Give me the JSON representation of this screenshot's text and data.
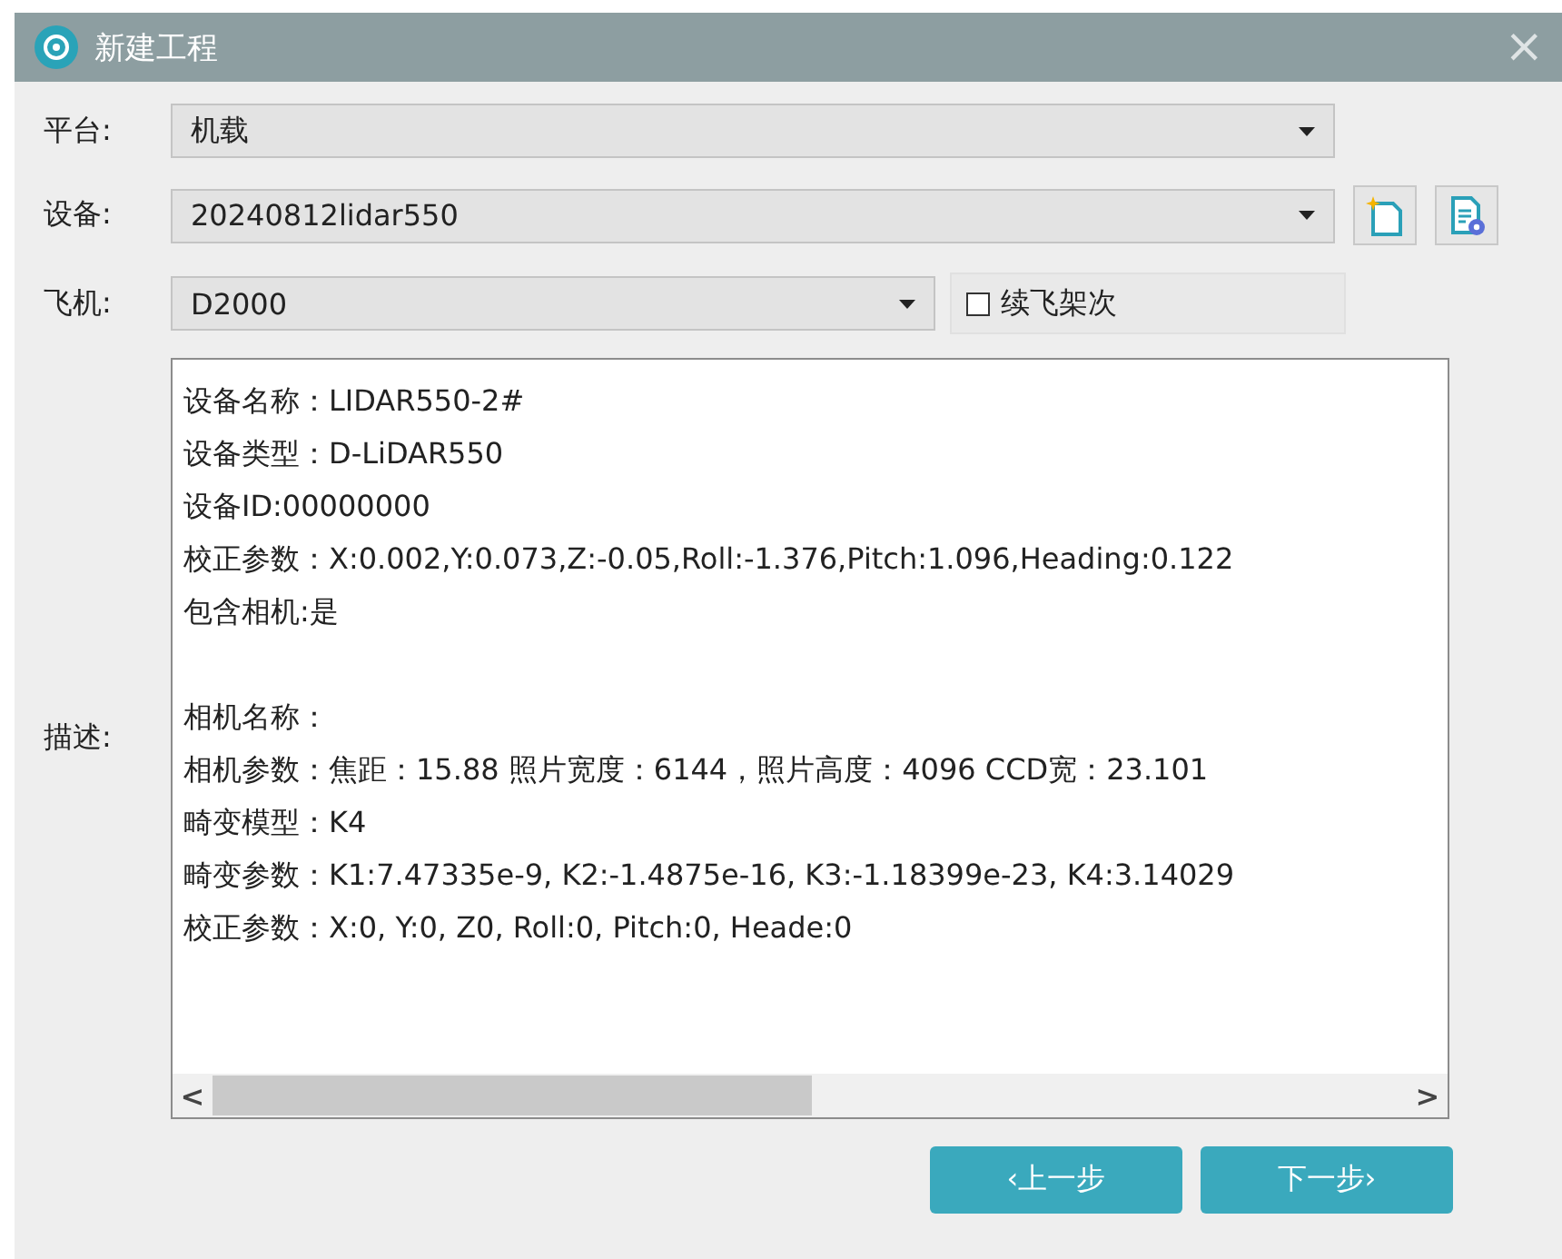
{
  "window": {
    "title": "新建工程",
    "close": "×"
  },
  "fields": [
    {
      "label": "平台:",
      "value": "机载",
      "kind": "combo"
    },
    {
      "label": "设备:",
      "value": "20240812lidar550",
      "kind": "combo-tools"
    },
    {
      "label": "飞机:",
      "value": "D2000",
      "kind": "combo-check",
      "check": {
        "label": "续飞架次",
        "checked": false
      }
    }
  ],
  "description": {
    "label": "描述:",
    "device_lines": [
      "设备名称：LIDAR550-2#",
      "设备类型：D-LiDAR550",
      "设备ID:00000000",
      "校正参数：X:0.002,Y:0.073,Z:-0.05,Roll:-1.376,Pitch:1.096,Heading:0.122",
      "包含相机:是"
    ],
    "camera_lines": [
      "相机名称：",
      "相机参数：焦距：15.88 照片宽度：6144，照片高度：4096 CCD宽：23.101",
      "畸变模型：K4",
      "畸变参数：K1:7.47335e-9, K2:-1.4875e-16, K3:-1.18399e-23, K4:3.14029",
      "校正参数：X:0, Y:0, Z0, Roll:0, Pitch:0, Heade:0"
    ],
    "scroll_left": "<",
    "scroll_right": ">"
  },
  "buttons": [
    {
      "label": "‹上一步"
    },
    {
      "label": "下一步›"
    }
  ]
}
